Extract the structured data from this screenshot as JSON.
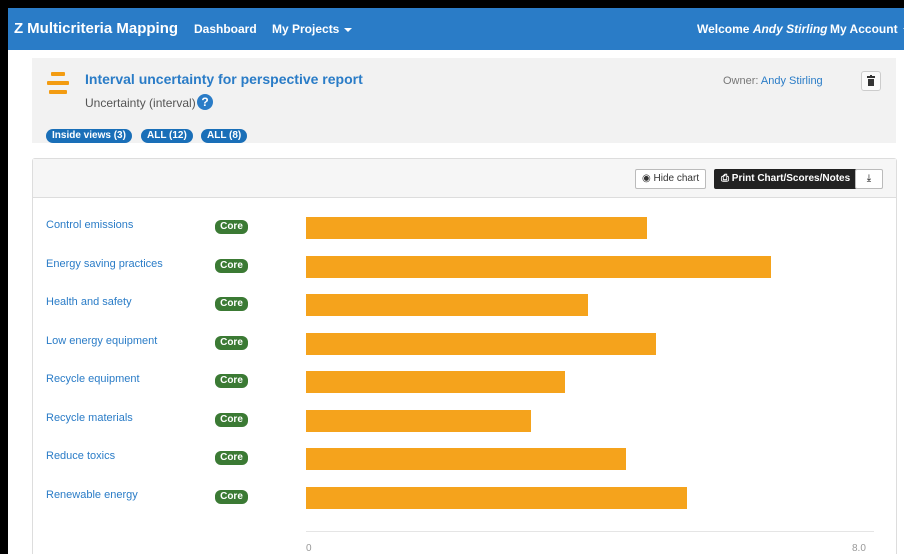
{
  "nav": {
    "brand": "Multicriteria Mapping",
    "brand_logo": "Z",
    "dashboard": "Dashboard",
    "projects": "My Projects",
    "welcome_prefix": "Welcome",
    "welcome_user": "Andy Stirling",
    "account": "My Account"
  },
  "header": {
    "title": "Interval uncertainty for perspective report",
    "subtitle": "Uncertainty (interval)",
    "owner_label": "Owner:",
    "owner_name": "Andy Stirling",
    "filters": [
      "Inside views (3)",
      "ALL (12)",
      "ALL (8)"
    ]
  },
  "toolbar": {
    "hide_chart": "Hide chart",
    "print": "Print Chart/Scores/Notes"
  },
  "rows": [
    {
      "label": "Control emissions",
      "badge": "Core"
    },
    {
      "label": "Energy saving practices",
      "badge": "Core"
    },
    {
      "label": "Health and safety",
      "badge": "Core"
    },
    {
      "label": "Low energy equipment",
      "badge": "Core"
    },
    {
      "label": "Recycle equipment",
      "badge": "Core"
    },
    {
      "label": "Recycle materials",
      "badge": "Core"
    },
    {
      "label": "Reduce toxics",
      "badge": "Core"
    },
    {
      "label": "Renewable energy",
      "badge": "Core"
    }
  ],
  "chart_data": {
    "type": "bar",
    "orientation": "horizontal",
    "categories": [
      "Control emissions",
      "Energy saving practices",
      "Health and safety",
      "Low energy equipment",
      "Recycle equipment",
      "Recycle materials",
      "Reduce toxics",
      "Renewable energy"
    ],
    "values": [
      4.8,
      6.55,
      3.97,
      4.93,
      3.65,
      3.17,
      4.51,
      5.37
    ],
    "xlim": [
      0,
      8.0
    ],
    "tick_labels": [
      "0",
      "8.0"
    ],
    "bar_color": "#f5a31c"
  },
  "colors": {
    "nav": "#2a7cc7",
    "badge": "#3b7a34",
    "bar": "#f5a31c"
  }
}
